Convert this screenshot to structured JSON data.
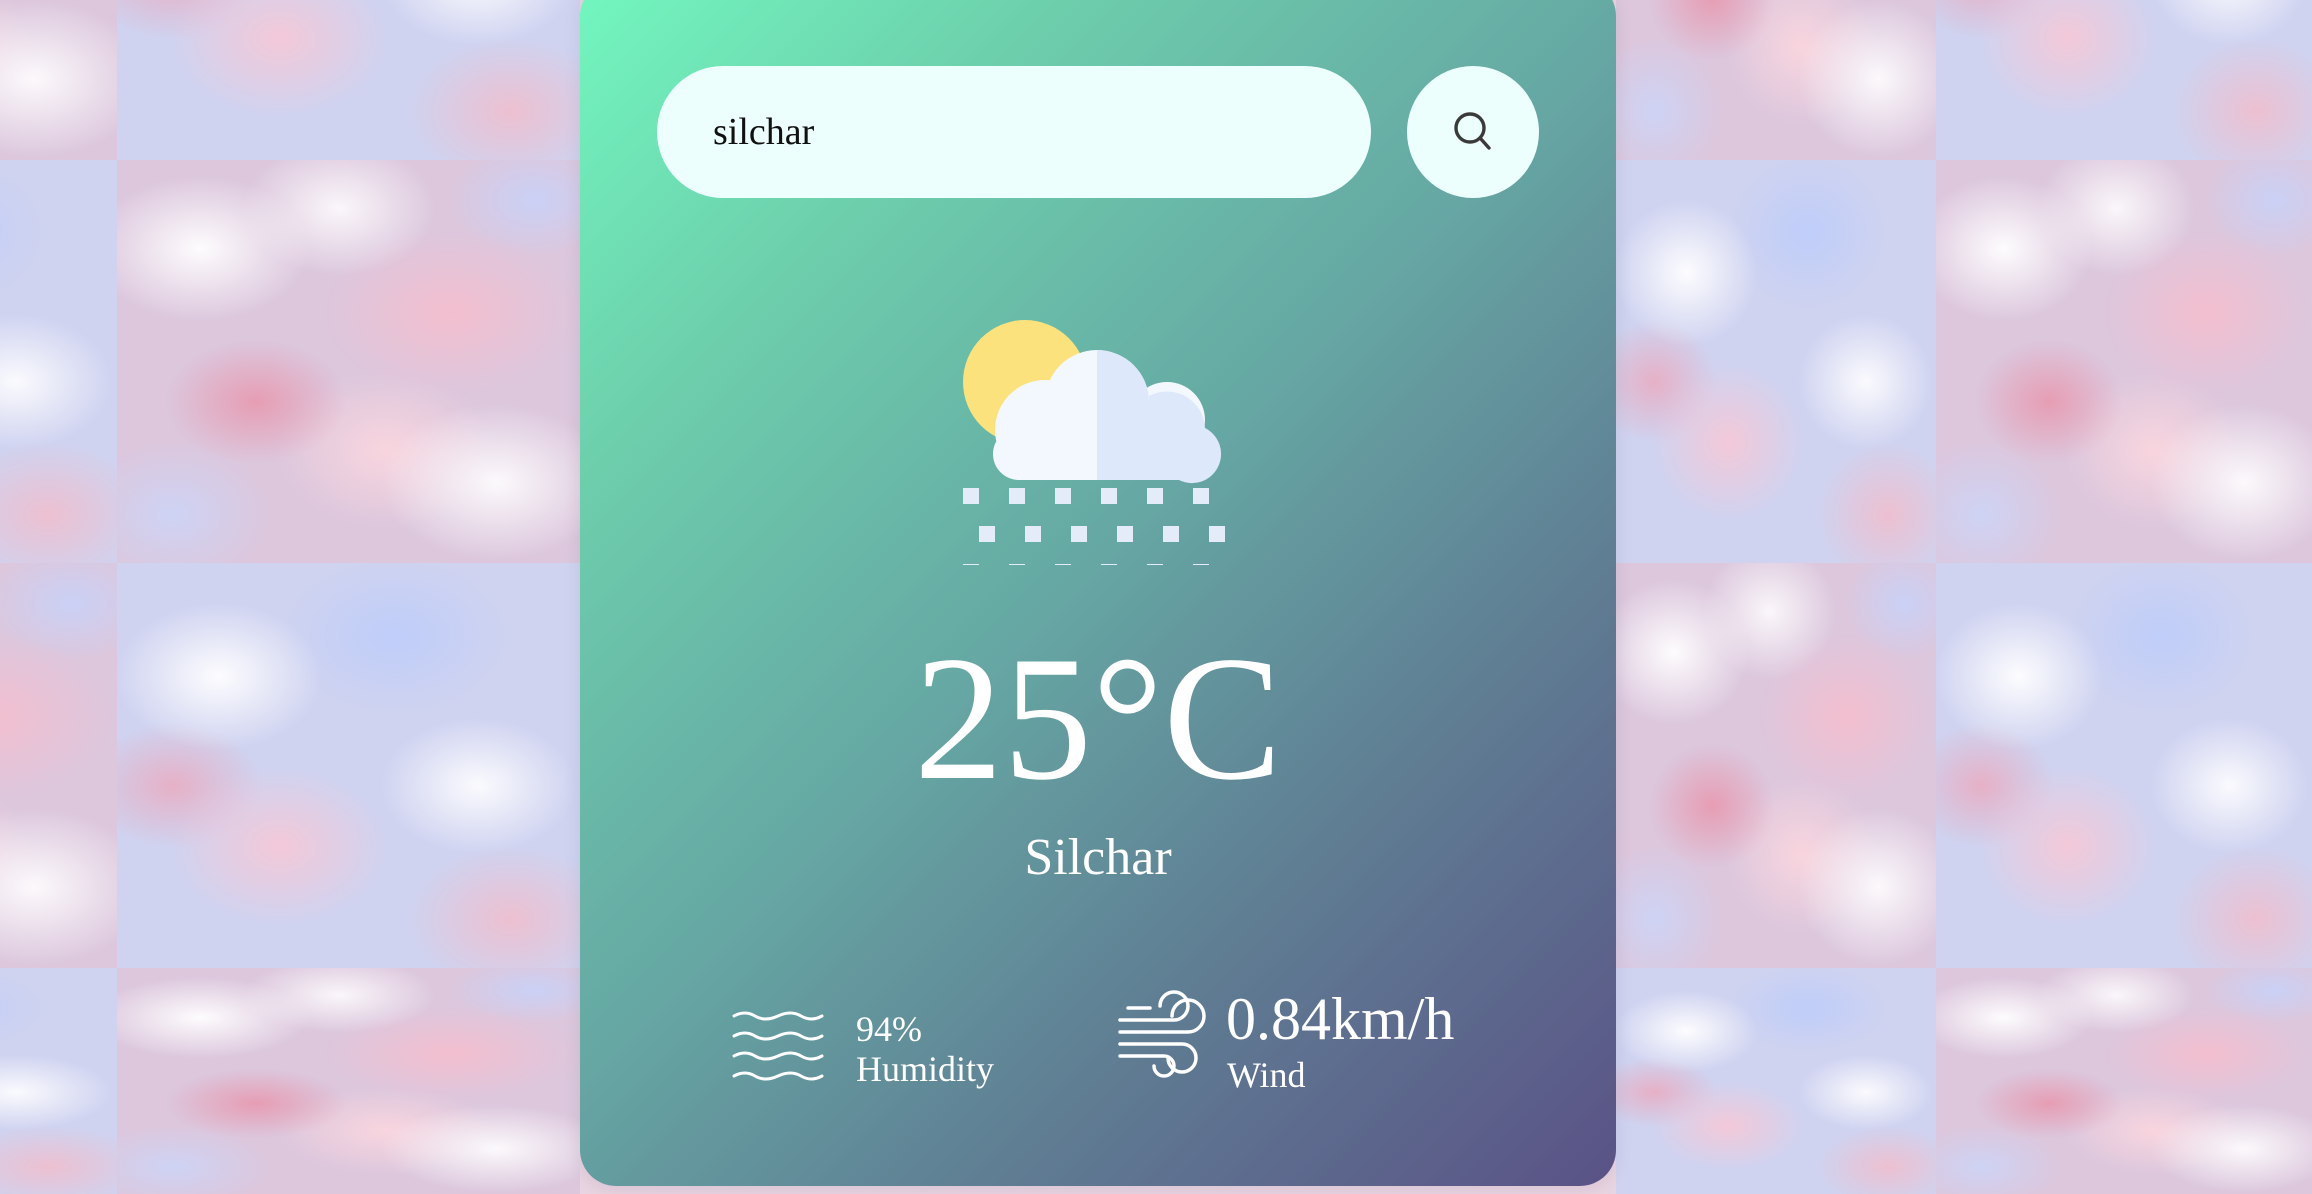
{
  "search": {
    "value": "silchar",
    "button_icon": "search-icon"
  },
  "weather": {
    "icon": "partly-cloudy-snow-icon",
    "temperature": "25°C",
    "city": "Silchar"
  },
  "details": {
    "humidity": {
      "icon": "humidity-waves-icon",
      "value": "94%",
      "label": "Humidity"
    },
    "wind": {
      "icon": "wind-icon",
      "value": "0.84km/h",
      "label": "Wind"
    }
  },
  "colors": {
    "card_gradient_start": "#72f7bf",
    "card_gradient_end": "#5a5286",
    "input_background": "#edfffc",
    "text": "#ffffff",
    "sun": "#fbe27d",
    "cloud": "#f3f8ff"
  }
}
